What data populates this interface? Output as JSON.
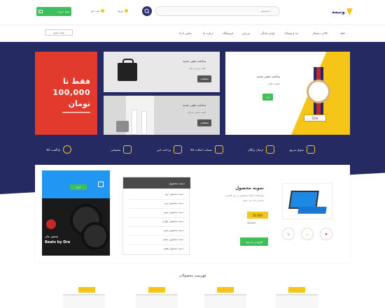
{
  "header": {
    "logo_text": "ونیمه",
    "search_placeholder": "جستجو...",
    "cart_label": "سبد خرید",
    "links": [
      "ورود",
      "ثبت نام"
    ]
  },
  "nav": {
    "items": [
      "خانه",
      "کالای دیجیتال",
      "مد و پوشاک",
      "لوازم خانگی",
      "ورزش",
      "فروشگاه",
      "درباره ما",
      "تماس با ما"
    ],
    "cart_button": "سبد خرید"
  },
  "promo_red": {
    "line1": "فقط تا",
    "line2": "100,000",
    "line3": "تومان"
  },
  "promo_bag": {
    "title": "ساعت مچی جدید",
    "subtitle": "کیف چرمی زنانه",
    "button": "مشاهده"
  },
  "promo_shoes": {
    "title": "ساعت مچی جدید",
    "subtitle": "کیف دستی مردانه",
    "button": "مشاهده"
  },
  "promo_watch": {
    "title": "ساعت مچی جدید",
    "subtitle": "کیفیت عالی",
    "button": "خرید",
    "price": "50%"
  },
  "features": [
    "تحویل سریع",
    "ارسال رایگان",
    "ضمانت اصالت کالا",
    "پرداخت امن",
    "پشتیبانی",
    "بازگشت کالا"
  ],
  "promo_side": {
    "button": "خرید",
    "brand_line": "هدفون های",
    "brand": "Beats by Dre"
  },
  "dropdown": {
    "header": "دسته محصول",
    "items": [
      "دسته محصول اول",
      "دسته محصول دوم",
      "دسته محصول سوم",
      "دسته محصول چهارم",
      "دسته محصول پنجم",
      "دسته محصول ششم",
      "دسته محصول هفتم"
    ]
  },
  "product": {
    "title": "نمونه محصول",
    "desc": [
      "توضیحات کوتاه محصول در این قسمت",
      "نمایش داده می شود"
    ],
    "price": "50,000",
    "old_price": "75,000",
    "button": "افزودن به سبد",
    "badges": [
      "%",
      "★",
      "♥"
    ]
  },
  "section_title": "فهرست محصولات",
  "colors": {
    "navy": "#262a62",
    "yellow": "#f5c518",
    "green": "#3fbf5a",
    "red": "#e23b2e",
    "blue": "#2196f3"
  }
}
